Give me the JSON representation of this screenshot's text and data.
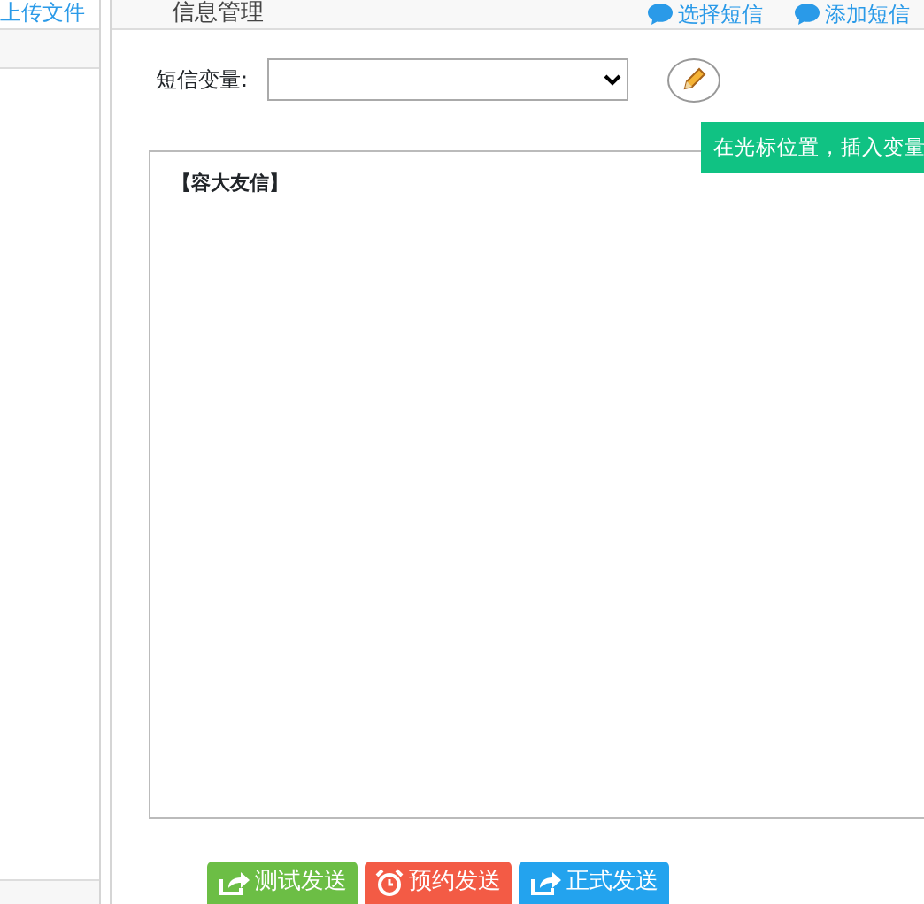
{
  "sidebar": {
    "link": "上传文件"
  },
  "header": {
    "title": "信息管理",
    "actions": [
      {
        "label": "选择短信"
      },
      {
        "label": "添加短信"
      }
    ]
  },
  "variable": {
    "label": "短信变量:",
    "tooltip": "在光标位置，插入变量"
  },
  "message": {
    "value": "【容大友信】"
  },
  "buttons": [
    {
      "label": "测试发送",
      "kind": "test"
    },
    {
      "label": "预约发送",
      "kind": "schedule"
    },
    {
      "label": "正式发送",
      "kind": "send"
    }
  ]
}
